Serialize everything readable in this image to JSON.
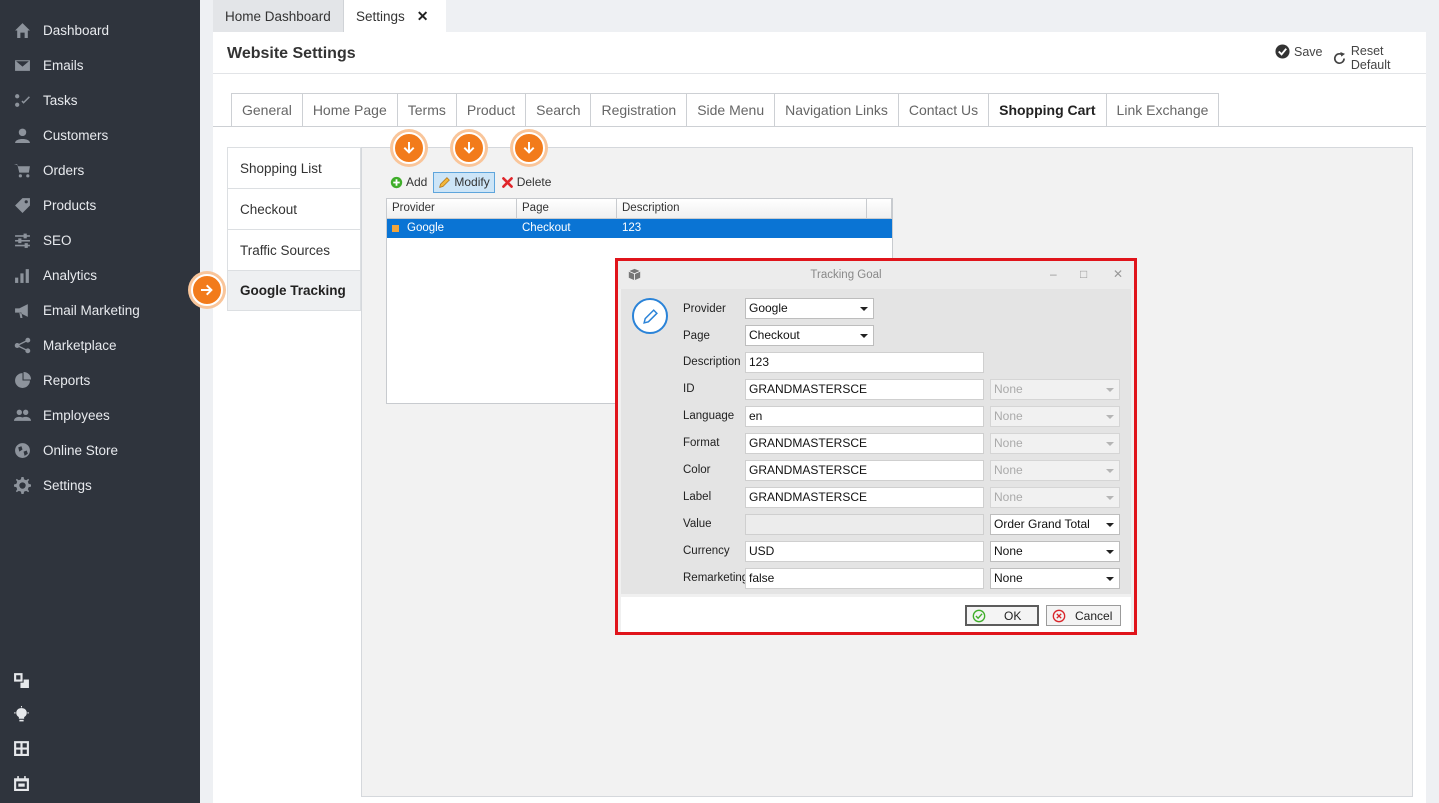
{
  "sidebar": {
    "items": [
      {
        "label": "Dashboard",
        "icon": "home-icon"
      },
      {
        "label": "Emails",
        "icon": "envelope-icon"
      },
      {
        "label": "Tasks",
        "icon": "tasks-icon"
      },
      {
        "label": "Customers",
        "icon": "user-icon"
      },
      {
        "label": "Orders",
        "icon": "cart-icon"
      },
      {
        "label": "Products",
        "icon": "tag-icon"
      },
      {
        "label": "SEO",
        "icon": "sliders-icon"
      },
      {
        "label": "Analytics",
        "icon": "bar-chart-icon"
      },
      {
        "label": "Email Marketing",
        "icon": "megaphone-icon"
      },
      {
        "label": "Marketplace",
        "icon": "share-icon"
      },
      {
        "label": "Reports",
        "icon": "pie-chart-icon"
      },
      {
        "label": "Employees",
        "icon": "users-icon"
      },
      {
        "label": "Online Store",
        "icon": "globe-icon"
      },
      {
        "label": "Settings",
        "icon": "gear-icon"
      }
    ],
    "bottom_icons": [
      "windows-icon",
      "lightbulb-icon",
      "calculator-icon",
      "calendar-icon"
    ]
  },
  "doc_tabs": {
    "home": "Home Dashboard",
    "settings": "Settings",
    "close": "✕"
  },
  "header": {
    "title": "Website Settings",
    "save": "Save",
    "reset": "Reset Default"
  },
  "settings_tabs": [
    "General",
    "Home Page",
    "Terms",
    "Product",
    "Search",
    "Registration",
    "Side Menu",
    "Navigation Links",
    "Contact Us",
    "Shopping Cart",
    "Link Exchange"
  ],
  "active_settings_tab": "Shopping Cart",
  "submenu": [
    "Shopping List",
    "Checkout",
    "Traffic Sources",
    "Google Tracking"
  ],
  "active_submenu": "Google Tracking",
  "toolbar": {
    "add": "Add",
    "modify": "Modify",
    "delete": "Delete"
  },
  "grid": {
    "columns": [
      "Provider",
      "Page",
      "Description"
    ],
    "rows": [
      {
        "provider": "Google",
        "page": "Checkout",
        "description": "123"
      }
    ]
  },
  "dialog": {
    "title": "Tracking Goal",
    "fields": {
      "provider": {
        "label": "Provider",
        "value": "Google"
      },
      "page": {
        "label": "Page",
        "value": "Checkout"
      },
      "description": {
        "label": "Description",
        "value": "123"
      },
      "id": {
        "label": "ID",
        "value": "GRANDMASTERSCE",
        "option": "None"
      },
      "language": {
        "label": "Language",
        "value": "en",
        "option": "None"
      },
      "format": {
        "label": "Format",
        "value": "GRANDMASTERSCE",
        "option": "None"
      },
      "color": {
        "label": "Color",
        "value": "GRANDMASTERSCE",
        "option": "None"
      },
      "label": {
        "label": "Label",
        "value": "GRANDMASTERSCE",
        "option": "None"
      },
      "value": {
        "label": "Value",
        "value": "",
        "option": "Order Grand Total"
      },
      "currency": {
        "label": "Currency",
        "value": "USD",
        "option": "None"
      },
      "remarketing": {
        "label": "Remarketing",
        "value": "false",
        "option": "None"
      }
    },
    "ok": "OK",
    "cancel": "Cancel"
  },
  "colors": {
    "sidebar_bg": "#2f343d",
    "accent_orange": "#f27b1b",
    "selection_blue": "#0a74d4",
    "highlight_red": "#e0141b"
  }
}
